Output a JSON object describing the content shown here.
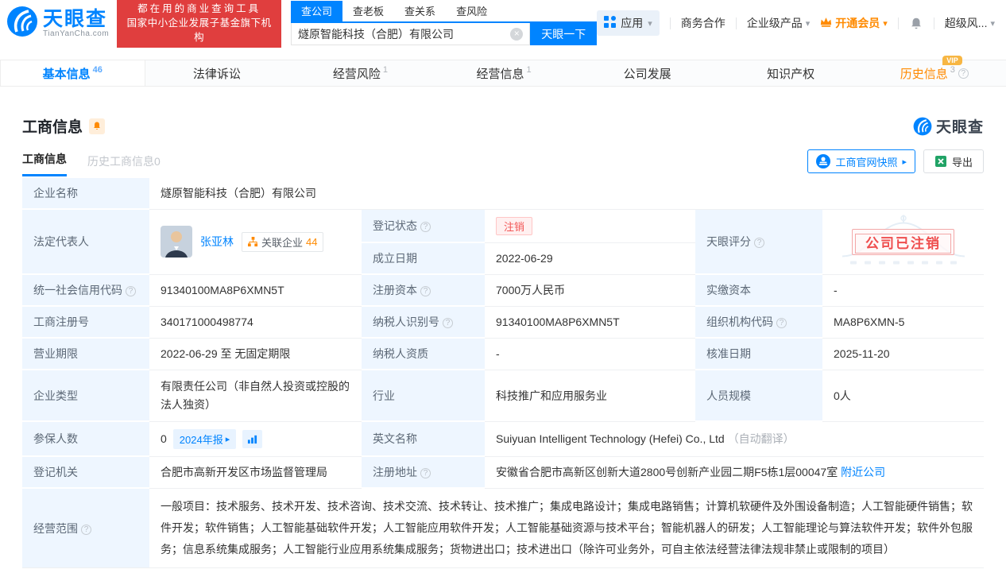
{
  "colors": {
    "accent": "#0084ff",
    "banner_red": "#e03e3e",
    "orange": "#ff8a00",
    "status_red": "#f25555",
    "label_bg": "#eef6ff"
  },
  "icons": {
    "caret": "▾",
    "arrow": "▸",
    "question": "?",
    "clear": "×",
    "vip": "VIP"
  },
  "header": {
    "logo_title": "天眼查",
    "logo_domain": "TianYanCha.com",
    "banner_line1": "都在用的商业查询工具",
    "banner_line2": "国家中小企业发展子基金旗下机构",
    "search_tabs": [
      {
        "label": "查公司"
      },
      {
        "label": "查老板"
      },
      {
        "label": "查关系"
      },
      {
        "label": "查风险"
      }
    ],
    "search_value": "燧原智能科技（合肥）有限公司",
    "search_button": "天眼一下",
    "menu_apps": "应用",
    "menu_coop": "商务合作",
    "menu_enterprise": "企业级产品",
    "menu_vip": "开通会员",
    "menu_risk": "超级风..."
  },
  "nav": {
    "tabs": [
      {
        "label": "基本信息",
        "count": "46"
      },
      {
        "label": "法律诉讼",
        "count": ""
      },
      {
        "label": "经营风险",
        "count": "1"
      },
      {
        "label": "经营信息",
        "count": "1"
      },
      {
        "label": "公司发展",
        "count": ""
      },
      {
        "label": "知识产权",
        "count": ""
      },
      {
        "label": "历史信息",
        "count": "3"
      }
    ]
  },
  "section": {
    "title": "工商信息",
    "brand": "天眼查",
    "subtab_active": "工商信息",
    "subtab_inactive": "历史工商信息0",
    "snapshot_button": "工商官网快照",
    "export_button": "导出"
  },
  "info": {
    "company_name_label": "企业名称",
    "company_name": "燧原智能科技（合肥）有限公司",
    "legal_rep_label": "法定代表人",
    "legal_rep_name": "张亚林",
    "related_label": "关联企业",
    "related_count": "44",
    "reg_status_label": "登记状态",
    "reg_status": "注销",
    "est_date_label": "成立日期",
    "est_date": "2022-06-29",
    "score_label": "天眼评分",
    "stamp_text": "公司已注销",
    "uscc_label": "统一社会信用代码",
    "uscc": "91340100MA8P6XMN5T",
    "reg_capital_label": "注册资本",
    "reg_capital": "7000万人民币",
    "paid_capital_label": "实缴资本",
    "paid_capital": "-",
    "reg_no_label": "工商注册号",
    "reg_no": "340171000498774",
    "taxpayer_id_label": "纳税人识别号",
    "taxpayer_id": "91340100MA8P6XMN5T",
    "org_code_label": "组织机构代码",
    "org_code": "MA8P6XMN-5",
    "term_label": "营业期限",
    "term": "2022-06-29 至 无固定期限",
    "taxpayer_quali_label": "纳税人资质",
    "taxpayer_quali": "-",
    "approval_date_label": "核准日期",
    "approval_date": "2025-11-20",
    "type_label": "企业类型",
    "type": "有限责任公司（非自然人投资或控股的法人独资）",
    "industry_label": "行业",
    "industry": "科技推广和应用服务业",
    "staff_label": "人员规模",
    "staff": "0人",
    "insured_label": "参保人数",
    "insured": "0",
    "annual_report": "2024年报",
    "en_name_label": "英文名称",
    "en_name": "Suiyuan Intelligent Technology (Hefei) Co., Ltd",
    "en_name_note": "（自动翻译）",
    "authority_label": "登记机关",
    "authority": "合肥市高新开发区市场监督管理局",
    "address_label": "注册地址",
    "address": "安徽省合肥市高新区创新大道2800号创新产业园二期F5栋1层00047室",
    "nearby": "附近公司",
    "scope_label": "经营范围",
    "scope": "一般项目：技术服务、技术开发、技术咨询、技术交流、技术转让、技术推广；集成电路设计；集成电路销售；计算机软硬件及外围设备制造；人工智能硬件销售；软件开发；软件销售；人工智能基础软件开发；人工智能应用软件开发；人工智能基础资源与技术平台；智能机器人的研发；人工智能理论与算法软件开发；软件外包服务；信息系统集成服务；人工智能行业应用系统集成服务；货物进出口；技术进出口（除许可业务外，可自主依法经营法律法规非禁止或限制的项目）"
  }
}
